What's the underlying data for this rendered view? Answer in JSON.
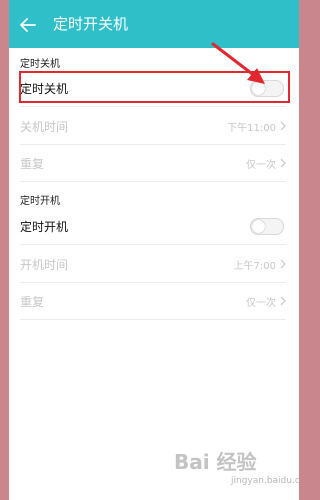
{
  "header": {
    "title": "定时开关机"
  },
  "shutdown": {
    "section_label": "定时关机",
    "toggle_label": "定时关机",
    "toggle_on": false,
    "time_label": "关机时间",
    "time_value": "下午11:00",
    "repeat_label": "重复",
    "repeat_value": "仅一次"
  },
  "startup": {
    "section_label": "定时开机",
    "toggle_label": "定时开机",
    "toggle_on": false,
    "time_label": "开机时间",
    "time_value": "上午7:00",
    "repeat_label": "重复",
    "repeat_value": "仅一次"
  },
  "watermark": {
    "text": "Bai 经验",
    "sub": "jingyan.baidu.com"
  },
  "colors": {
    "header": "#2ebfc9",
    "highlight": "#e4262f",
    "border": "#c9868c"
  }
}
